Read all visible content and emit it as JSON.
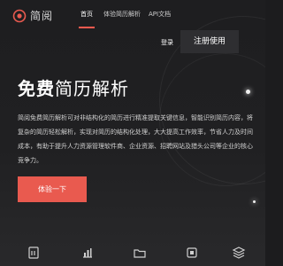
{
  "header": {
    "logo_text": "简阅",
    "nav": [
      {
        "label": "首页",
        "active": true
      },
      {
        "label": "体验简历解析",
        "active": false
      },
      {
        "label": "API文档",
        "active": false
      }
    ],
    "login_label": "登录",
    "register_label": "注册使用"
  },
  "hero": {
    "title_bold": "免费",
    "title_light": "简历解析",
    "description": "简阅免费简历解析可对非结构化的简历进行精准提取关键信息，智能识别简历内容，将复杂的简历轻松解析，实现对简历的结构化处理，大大提高工作效率，节省人力及时间成本，有助于提升人力资源管理软件商、企业资源、招聘网站及猎头公司等企业的核心竞争力。",
    "cta_label": "体验一下"
  },
  "features": {
    "icons": [
      "document-icon",
      "chart-bars-icon",
      "folder-icon",
      "box-icon",
      "stack-icon"
    ]
  },
  "colors": {
    "accent": "#e95a4f",
    "background": "#1c1c1e",
    "register_bg": "#2e2e31"
  }
}
